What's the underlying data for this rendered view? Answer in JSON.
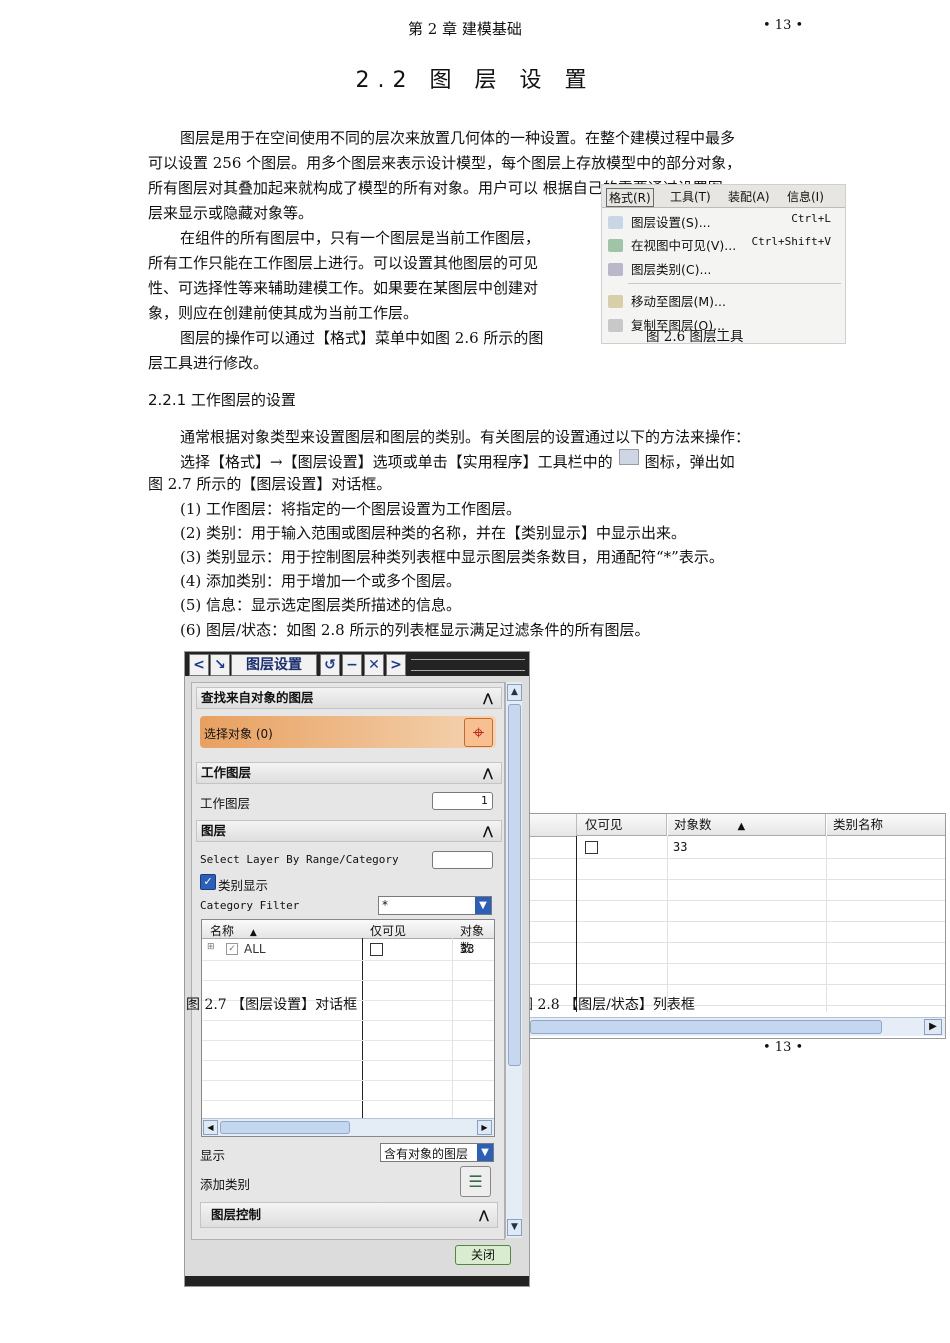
{
  "header": {
    "chapter": "第 2 章    建模基础",
    "page": "• 13 •"
  },
  "section_title": "2.2   图 层 设 置",
  "intro": {
    "l1": "图层是用于在空间使用不同的层次来放置几何体的一种设置。在整个建模过程中最多",
    "l2": "可以设置 256 个图层。用多个图层来表示设计模型，每个图层上存放模型中的部分对象，",
    "l3": "所有图层对其叠加起来就构成了模型的所有对象。用户可以 根据自己的需要通过设置图",
    "l4": "层来显示或隐藏对象等。",
    "p2l1": "在组件的所有图层中，只有一个图层是当前工作图层，",
    "p2l2": "所有工作只能在工作图层上进行。可以设置其他图层的可见",
    "p2l3": "性、可选择性等来辅助建模工作。如果要在某图层中创建对",
    "p2l4": "象，则应在创建前使其成为当前工作层。",
    "p3l1": "图层的操作可以通过【格式】菜单中如图 2.6 所示的图",
    "p3l2": "层工具进行修改。"
  },
  "menu": {
    "bar": [
      "格式(R)",
      "工具(T)",
      "装配(A)",
      "信息(I)"
    ],
    "items": [
      {
        "label": "图层设置(S)...",
        "shortcut": "Ctrl+L"
      },
      {
        "label": "在视图中可见(V)...",
        "shortcut": "Ctrl+Shift+V"
      },
      {
        "label": "图层类别(C)..."
      },
      {
        "label": "移动至图层(M)..."
      },
      {
        "label": "复制至图层(O)..."
      }
    ],
    "caption": "图 2.6   图层工具"
  },
  "subsection": "2.2.1   工作图层的设置",
  "body": {
    "l1": "通常根据对象类型来设置图层和图层的类别。有关图层的设置通过以下的方法来操作：",
    "l2a": "选择【格式】→【图层设置】选项或单击【实用程序】工具栏中的",
    "l2b": "图标，弹出如",
    "l3": "图 2.7 所示的【图层设置】对话框。"
  },
  "items": [
    "(1)  工作图层：将指定的一个图层设置为工作图层。",
    "(2)  类别：用于输入范围或图层种类的名称，并在【类别显示】中显示出来。",
    "(3)  类别显示：用于控制图层种类列表框中显示图层类条数目，用通配符“*”表示。",
    "(4)  添加类别：用于增加一个或多个图层。",
    "(5)  信息：显示选定图层类所描述的信息。",
    "(6)  图层/状态：如图 2.8 所示的列表框显示满足过滤条件的所有图层。"
  ],
  "dialog": {
    "title": "图层设置",
    "find_group": "查找来自对象的图层",
    "select_object": "选择对象 (0)",
    "work_group": "工作图层",
    "work_label": "工作图层",
    "work_value": "1",
    "layers_group": "图层",
    "select_by_range": "Select Layer By Range/Category",
    "category_display": "类别显示",
    "category_filter": "Category Filter",
    "filter_value": "*",
    "col_name": "名称",
    "col_visible": "仅可见",
    "col_count": "对象数",
    "row_name": "ALL",
    "row_count": "33",
    "display_label": "显示",
    "display_value": "含有对象的图层",
    "add_category": "添加类别",
    "layer_control": "图层控制",
    "close": "关闭",
    "caption": "图 2.7  【图层设置】对话框"
  },
  "table": {
    "cols": [
      "仅可见",
      "对象数",
      "类别名称"
    ],
    "row_count": "33",
    "caption": "图 2.8  【图层/状态】列表框",
    "page": "• 13 •"
  }
}
